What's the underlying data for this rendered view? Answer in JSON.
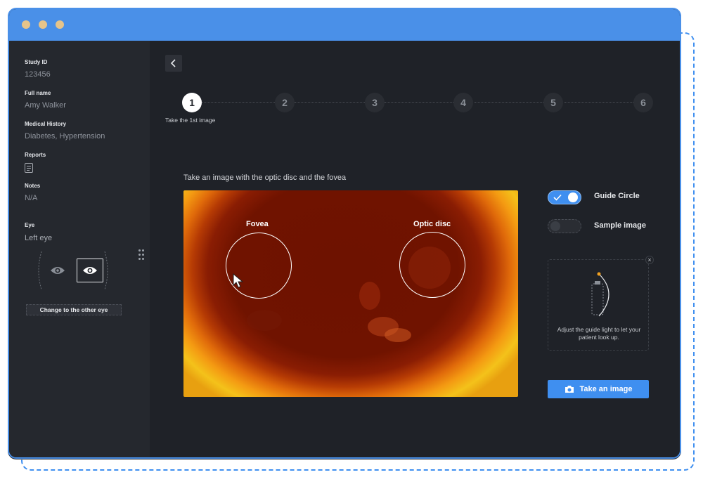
{
  "sidebar": {
    "study_id_label": "Study ID",
    "study_id": "123456",
    "full_name_label": "Full name",
    "full_name": "Amy Walker",
    "medical_history_label": "Medical History",
    "medical_history": "Diabetes, Hypertension",
    "reports_label": "Reports",
    "notes_label": "Notes",
    "notes": "N/A",
    "eye_label": "Eye",
    "eye": "Left eye",
    "change_eye_button": "Change to the other eye"
  },
  "stepper": {
    "steps": [
      "1",
      "2",
      "3",
      "4",
      "5",
      "6"
    ],
    "active_index": 0,
    "active_caption": "Take the 1st image"
  },
  "capture": {
    "instruction": "Take an image with the optic disc and the fovea",
    "fovea_label": "Fovea",
    "optic_disc_label": "Optic disc"
  },
  "controls": {
    "guide_circle_label": "Guide Circle",
    "guide_circle_on": true,
    "sample_image_label": "Sample image",
    "sample_image_on": false,
    "guide_card_text": "Adjust the guide light to let your patient look up.",
    "guide_close_glyph": "×",
    "take_image_button": "Take an image"
  },
  "colors": {
    "accent": "#3f8ff0",
    "titlebar": "#4a90e8",
    "window_dots": "#e6c48a",
    "background": "#1f2228",
    "sidebar": "#25282e"
  },
  "icons": [
    "report-icon",
    "eye-icon",
    "back-chevron-icon",
    "camera-icon",
    "check-icon",
    "drag-handle-icon",
    "close-icon",
    "mouse-cursor-icon"
  ]
}
